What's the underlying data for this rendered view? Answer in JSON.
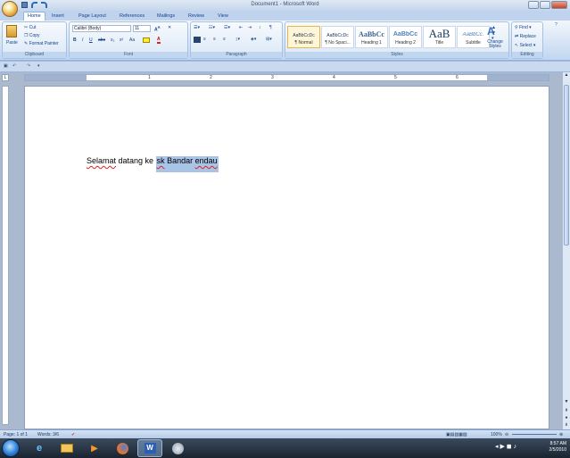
{
  "window": {
    "title": "Document1 - Microsoft Word"
  },
  "tabs": [
    "Home",
    "Insert",
    "Page Layout",
    "References",
    "Mailings",
    "Review",
    "View"
  ],
  "clipboard": {
    "paste": "Paste",
    "cut": "Cut",
    "copy": "Copy",
    "format_painter": "Format Painter",
    "label": "Clipboard"
  },
  "font": {
    "name": "Calibri (Body)",
    "size": "11",
    "label": "Font"
  },
  "paragraph": {
    "label": "Paragraph"
  },
  "styles": {
    "label": "Styles",
    "items": [
      {
        "sample": "AaBbCcDc",
        "name": "¶ Normal"
      },
      {
        "sample": "AaBbCcDc",
        "name": "¶ No Spaci..."
      },
      {
        "sample": "AaBbCc",
        "name": "Heading 1"
      },
      {
        "sample": "AaBbCc",
        "name": "Heading 2"
      },
      {
        "sample": "AaB",
        "name": "Title"
      },
      {
        "sample": "AaBbCc.",
        "name": "Subtitle"
      }
    ],
    "change_styles": "Change Styles"
  },
  "editing": {
    "find": "Find",
    "replace": "Replace",
    "select": "Select",
    "label": "Editing"
  },
  "document": {
    "text_before": "Selamat",
    "text_mid": " datang ke ",
    "text_selected_1": "sk",
    "text_selected_2": " Bandar ",
    "text_selected_3": "endau"
  },
  "ruler_numbers": [
    "1",
    "2",
    "3",
    "4",
    "5",
    "6"
  ],
  "status": {
    "page": "Page: 1 of 1",
    "words": "Words: 3/6",
    "zoom": "100%"
  },
  "tray": {
    "time": "8:57 AM",
    "date": "2/5/2010"
  },
  "colors": {
    "selection": "#a8c4e7",
    "squiggle": "#e02020",
    "ribbon_bg": "#d4e3f5"
  }
}
